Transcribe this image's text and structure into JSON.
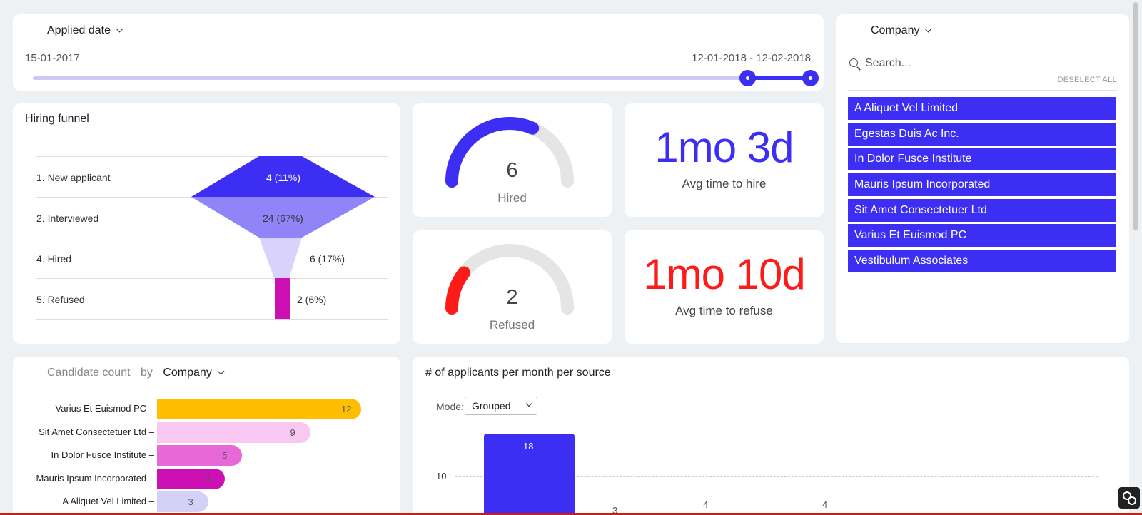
{
  "colors": {
    "accent": "#3c2ef2",
    "refuse_red": "#ff1a1a",
    "funnel_light": "#8f84f8",
    "funnel_lighter": "#d9d3fb",
    "funnel_magenta": "#cc10b4",
    "gauge_track": "#e5e5e5"
  },
  "date_filter": {
    "label": "Applied date",
    "start": "15-01-2017",
    "range": "12-01-2018 - 12-02-2018"
  },
  "company_filter": {
    "label": "Company",
    "search_placeholder": "Search...",
    "deselect_label": "DESELECT ALL",
    "items": [
      "A Aliquet Vel Limited",
      "Egestas Duis Ac Inc.",
      "In Dolor Fusce Institute",
      "Mauris Ipsum Incorporated",
      "Sit Amet Consectetuer Ltd",
      "Varius Et Euismod PC",
      "Vestibulum Associates"
    ]
  },
  "funnel": {
    "title": "Hiring funnel",
    "stages": [
      {
        "label": "1. New applicant",
        "value": "4 (11%)"
      },
      {
        "label": "2. Interviewed",
        "value": "24 (67%)"
      },
      {
        "label": "4. Hired",
        "value": "6 (17%)"
      },
      {
        "label": "5. Refused",
        "value": "2 (6%)"
      }
    ]
  },
  "gauges": {
    "hired": {
      "value": "6",
      "label": "Hired",
      "fraction": 0.63
    },
    "refused": {
      "value": "2",
      "label": "Refused",
      "fraction": 0.21
    }
  },
  "metrics": {
    "hire_time": {
      "value": "1mo 3d",
      "label": "Avg time to hire"
    },
    "refuse_time": {
      "value": "1mo 10d",
      "label": "Avg time to refuse"
    }
  },
  "candidate_count": {
    "title": "Candidate count",
    "by": "by",
    "group": "Company"
  },
  "applicants": {
    "title": "# of applicants per month per source",
    "mode_label": "Mode:",
    "mode_value": "Grouped",
    "tick_10": "10"
  },
  "chart_data": [
    {
      "type": "bar",
      "orientation": "horizontal",
      "categories": [
        "Varius Et Euismod PC",
        "Sit Amet Consectetuer Ltd",
        "In Dolor Fusce Institute",
        "Mauris Ipsum Incorporated",
        "A Aliquet Vel Limited"
      ],
      "values": [
        12,
        9,
        5,
        4,
        3
      ],
      "colors": [
        "#ffbf00",
        "#f8c8f2",
        "#e868d8",
        "#cc10b4",
        "#d4d0f6"
      ]
    },
    {
      "type": "bar",
      "title": "# of applicants per month per source",
      "values": [
        18,
        3,
        4,
        4
      ],
      "yticks": [
        10
      ],
      "grid": true
    }
  ]
}
